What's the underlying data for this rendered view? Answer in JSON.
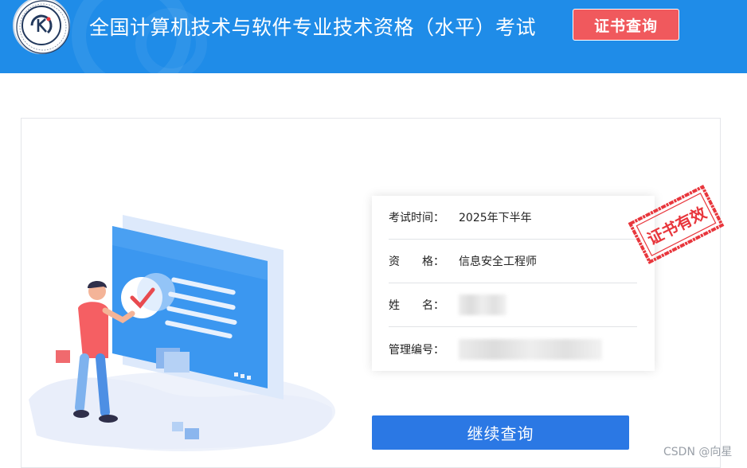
{
  "header": {
    "title": "全国计算机技术与软件专业技术资格（水平）考试",
    "cert_query_button": "证书查询",
    "logo_icon": "ceiaec-logo-icon"
  },
  "result": {
    "rows": [
      {
        "label": "考试时间：",
        "value": "2025年下半年"
      },
      {
        "label": "资　　格：",
        "value": "信息安全工程师"
      },
      {
        "label": "姓　　名：",
        "value": ""
      },
      {
        "label": "管理编号：",
        "value": ""
      }
    ],
    "stamp_text": "证书有效"
  },
  "continue_button": "继续查询",
  "watermark": "CSDN @向星",
  "colors": {
    "header_bg": "#1f8ce8",
    "cert_button_bg": "#f0595d",
    "continue_button_bg": "#2b78e4",
    "stamp": "#e8363c"
  }
}
